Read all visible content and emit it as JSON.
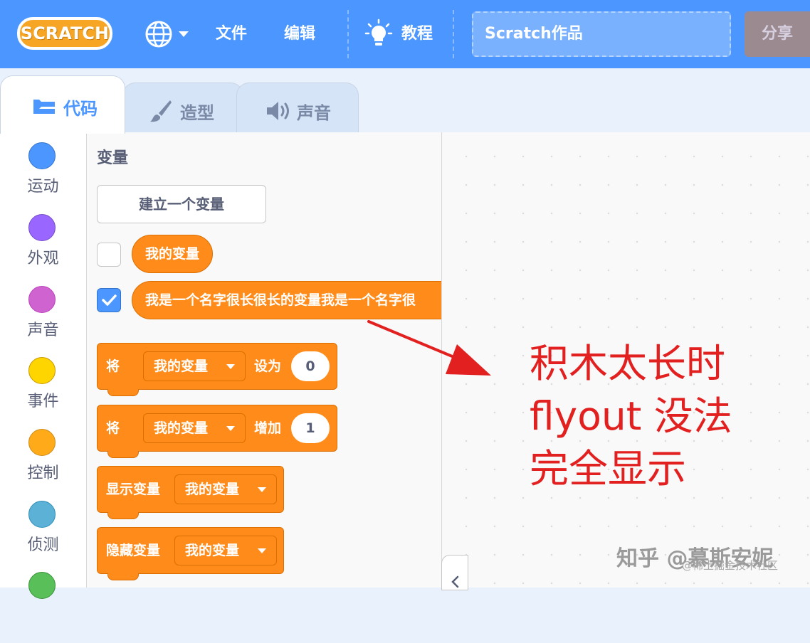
{
  "menubar": {
    "logo": "SCRATCH",
    "file": "文件",
    "edit": "编辑",
    "tutorials": "教程",
    "project_title": "Scratch作品",
    "share": "分享",
    "bar_color": "#4c97ff"
  },
  "tabs": [
    {
      "label": "代码",
      "icon": "code-icon",
      "active": true
    },
    {
      "label": "造型",
      "icon": "paintbrush-icon",
      "active": false
    },
    {
      "label": "声音",
      "icon": "speaker-icon",
      "active": false
    }
  ],
  "categories": [
    {
      "label": "运动",
      "color": "#4c97ff"
    },
    {
      "label": "外观",
      "color": "#9966ff"
    },
    {
      "label": "声音",
      "color": "#cf63cf"
    },
    {
      "label": "事件",
      "color": "#ffd500"
    },
    {
      "label": "控制",
      "color": "#ffab19"
    },
    {
      "label": "侦测",
      "color": "#5cb1d6"
    },
    {
      "label": "",
      "color": "#59c059"
    }
  ],
  "flyout": {
    "title": "变量",
    "make_variable": "建立一个变量",
    "var1": "我的变量",
    "var2": "我是一个名字很长很长的变量我是一个名字很",
    "set_block": {
      "prefix": "将",
      "dropdown": "我的变量",
      "middle": "设为",
      "value": "0"
    },
    "change_block": {
      "prefix": "将",
      "dropdown": "我的变量",
      "middle": "增加",
      "value": "1"
    },
    "show_block": {
      "label": "显示变量",
      "dropdown": "我的变量"
    },
    "hide_block": {
      "label": "隐藏变量",
      "dropdown": "我的变量"
    },
    "block_color": "#ff8c1a"
  },
  "annotation": {
    "lines": [
      "积木太长时",
      "flyout 没法",
      "完全显示"
    ],
    "color": "#e32020"
  },
  "watermark": {
    "main": "知乎 @慕斯安妮",
    "sub": "@稀土掘金技术社区"
  }
}
